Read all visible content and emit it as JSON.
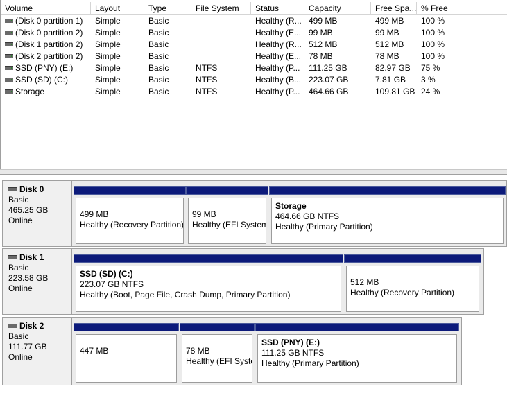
{
  "columns": [
    {
      "label": "Volume"
    },
    {
      "label": "Layout"
    },
    {
      "label": "Type"
    },
    {
      "label": "File System"
    },
    {
      "label": "Status"
    },
    {
      "label": "Capacity"
    },
    {
      "label": "Free Spa..."
    },
    {
      "label": "% Free"
    }
  ],
  "volumes": [
    {
      "volume": "(Disk 0 partition 1)",
      "layout": "Simple",
      "type": "Basic",
      "fs": "",
      "status": "Healthy (R...",
      "capacity": "499 MB",
      "free": "499 MB",
      "pct": "100 %"
    },
    {
      "volume": "(Disk 0 partition 2)",
      "layout": "Simple",
      "type": "Basic",
      "fs": "",
      "status": "Healthy (E...",
      "capacity": "99 MB",
      "free": "99 MB",
      "pct": "100 %"
    },
    {
      "volume": "(Disk 1 partition 2)",
      "layout": "Simple",
      "type": "Basic",
      "fs": "",
      "status": "Healthy (R...",
      "capacity": "512 MB",
      "free": "512 MB",
      "pct": "100 %"
    },
    {
      "volume": "(Disk 2 partition 2)",
      "layout": "Simple",
      "type": "Basic",
      "fs": "",
      "status": "Healthy (E...",
      "capacity": "78 MB",
      "free": "78 MB",
      "pct": "100 %"
    },
    {
      "volume": "SSD (PNY) (E:)",
      "layout": "Simple",
      "type": "Basic",
      "fs": "NTFS",
      "status": "Healthy (P...",
      "capacity": "111.25 GB",
      "free": "82.97 GB",
      "pct": "75 %"
    },
    {
      "volume": "SSD (SD) (C:)",
      "layout": "Simple",
      "type": "Basic",
      "fs": "NTFS",
      "status": "Healthy (B...",
      "capacity": "223.07 GB",
      "free": "7.81 GB",
      "pct": "3 %"
    },
    {
      "volume": "Storage",
      "layout": "Simple",
      "type": "Basic",
      "fs": "NTFS",
      "status": "Healthy (P...",
      "capacity": "464.66 GB",
      "free": "109.81 GB",
      "pct": "24 %"
    }
  ],
  "disks": [
    {
      "name": "Disk 0",
      "type": "Basic",
      "size": "465.25 GB",
      "state": "Online",
      "partitions": [
        {
          "name": "",
          "size": "499 MB",
          "status": "Healthy (Recovery Partition)"
        },
        {
          "name": "",
          "size": "99 MB",
          "status": "Healthy (EFI System Partition)"
        },
        {
          "name": "Storage",
          "size": "464.66 GB NTFS",
          "status": "Healthy (Primary Partition)"
        }
      ]
    },
    {
      "name": "Disk 1",
      "type": "Basic",
      "size": "223.58 GB",
      "state": "Online",
      "partitions": [
        {
          "name": "SSD (SD)  (C:)",
          "size": "223.07 GB NTFS",
          "status": "Healthy (Boot, Page File, Crash Dump, Primary Partition)"
        },
        {
          "name": "",
          "size": "512 MB",
          "status": "Healthy (Recovery Partition)"
        }
      ]
    },
    {
      "name": "Disk 2",
      "type": "Basic",
      "size": "111.77 GB",
      "state": "Online",
      "partitions": [
        {
          "name": "",
          "size": "447 MB",
          "status": ""
        },
        {
          "name": "",
          "size": "78 MB",
          "status": "Healthy (EFI System Partition)"
        },
        {
          "name": "SSD (PNY)  (E:)",
          "size": "111.25 GB NTFS",
          "status": "Healthy (Primary Partition)"
        }
      ]
    }
  ],
  "colors": {
    "partition_bar": "#0c1a7a",
    "panel": "#f0f0f0",
    "border": "#a0a0a0"
  }
}
